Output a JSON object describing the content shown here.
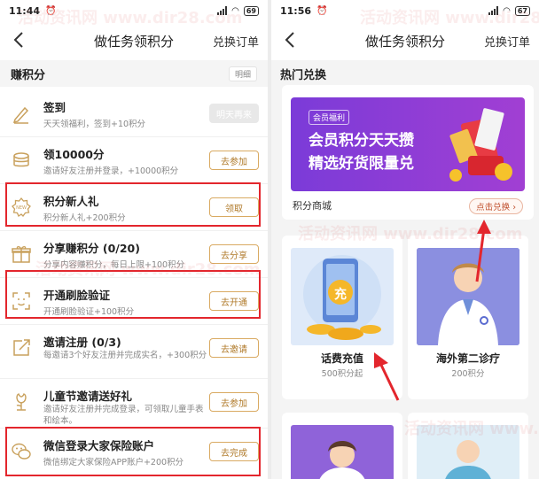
{
  "left": {
    "status": {
      "time": "11:44",
      "battery": "69"
    },
    "nav": {
      "title": "做任务领积分",
      "right": "兑换订单"
    },
    "earn": {
      "label": "赚积分",
      "detail": "明细"
    },
    "tasks": [
      {
        "name": "签到",
        "desc": "天天领福利，签到+10积分",
        "button": "明天再来",
        "icon": "pen-icon"
      },
      {
        "name": "领10000分",
        "desc": "邀请好友注册并登录，+10000积分",
        "button": "去参加",
        "icon": "coins-icon"
      },
      {
        "name": "积分新人礼",
        "desc": "积分新人礼+200积分",
        "button": "领取",
        "icon": "new-gift-icon"
      },
      {
        "name": "分享赚积分 (0/20)",
        "desc": "分享内容赚积分，每日上限+100积分",
        "button": "去分享",
        "icon": "share-gift-icon"
      },
      {
        "name": "开通刷脸验证",
        "desc": "开通刷脸验证+100积分",
        "button": "去开通",
        "icon": "face-scan-icon"
      },
      {
        "name": "邀请注册 (0/3)",
        "desc": "每邀请3个好友注册并完成实名，+300积分",
        "button": "去邀请",
        "icon": "invite-icon"
      },
      {
        "name": "儿童节邀请送好礼",
        "desc": "邀请好友注册并完成登录，可领取儿童手表和绘本。",
        "button": "去参加",
        "icon": "flower-icon"
      },
      {
        "name": "微信登录大家保险账户",
        "desc": "微信绑定大家保险APP账户+200积分",
        "button": "去完成",
        "icon": "wechat-icon"
      }
    ]
  },
  "right": {
    "status": {
      "time": "11:56",
      "battery": "67"
    },
    "nav": {
      "title": "做任务领积分",
      "right": "兑换订单"
    },
    "hot_title": "热门兑换",
    "banner": {
      "badge": "会员福利",
      "line1": "会员积分天天攒",
      "line2": "精选好货限量兑"
    },
    "mall_label": "积分商城",
    "redeem_button": "点击兑换 ›",
    "products": [
      {
        "name": "话费充值",
        "price": "500积分起",
        "glyph": "充"
      },
      {
        "name": "海外第二诊疗",
        "price": "200积分"
      }
    ]
  },
  "watermark": "活动资讯网 www.dir28.com",
  "colors": {
    "accent": "#d9aa62",
    "highlight": "#e3262d",
    "banner": "#8a3ddb"
  }
}
